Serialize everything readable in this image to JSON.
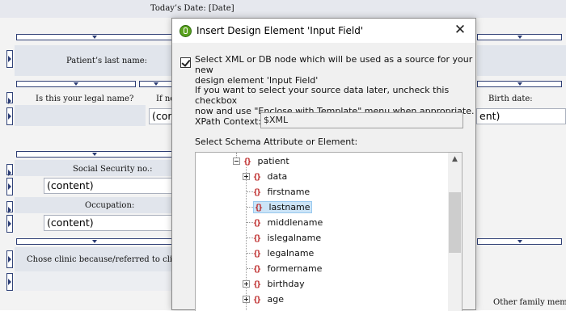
{
  "form": {
    "todays_date": "Today’s Date: [Date]",
    "patient_last_name": "Patient’s last name:",
    "legal_name_q": "Is this your legal name?",
    "if_not": "If no",
    "birth_date": "Birth date:",
    "content_trunc_left": "(con",
    "content_trunc_right": "ent)",
    "ssn": "Social Security no.:",
    "ssn_value": "(content)",
    "occupation": "Occupation:",
    "occupation_value": "(content)",
    "clinic": "Chose clinic because/referred to clinic by",
    "other_family": "Other family member"
  },
  "dialog": {
    "title": "Insert Design Element 'Input Field'",
    "checkbox_checked": true,
    "checkbox_label_line1": "Select XML or DB node which will be used as a source for your new",
    "checkbox_label_line2": "design element 'Input Field'",
    "hint_line1": "If you want to select your source data later, uncheck this checkbox",
    "hint_line2": "now and use \"Enclose with Template\" menu when appropriate.",
    "xpath_label": "XPath Context:",
    "xpath_value": "$XML",
    "tree_label": "Select Schema Attribute or Element:",
    "tree": {
      "root": "patient",
      "children": [
        "data",
        "firstname",
        "lastname",
        "middlename",
        "islegalname",
        "legalname",
        "formername",
        "birthday",
        "age"
      ],
      "selected": "lastname"
    }
  },
  "icons": {
    "app": "altova-app-icon",
    "close": "close-icon",
    "element": "element-braces-icon",
    "expand": "plus-expander-icon",
    "collapse": "minus-expander-icon"
  }
}
